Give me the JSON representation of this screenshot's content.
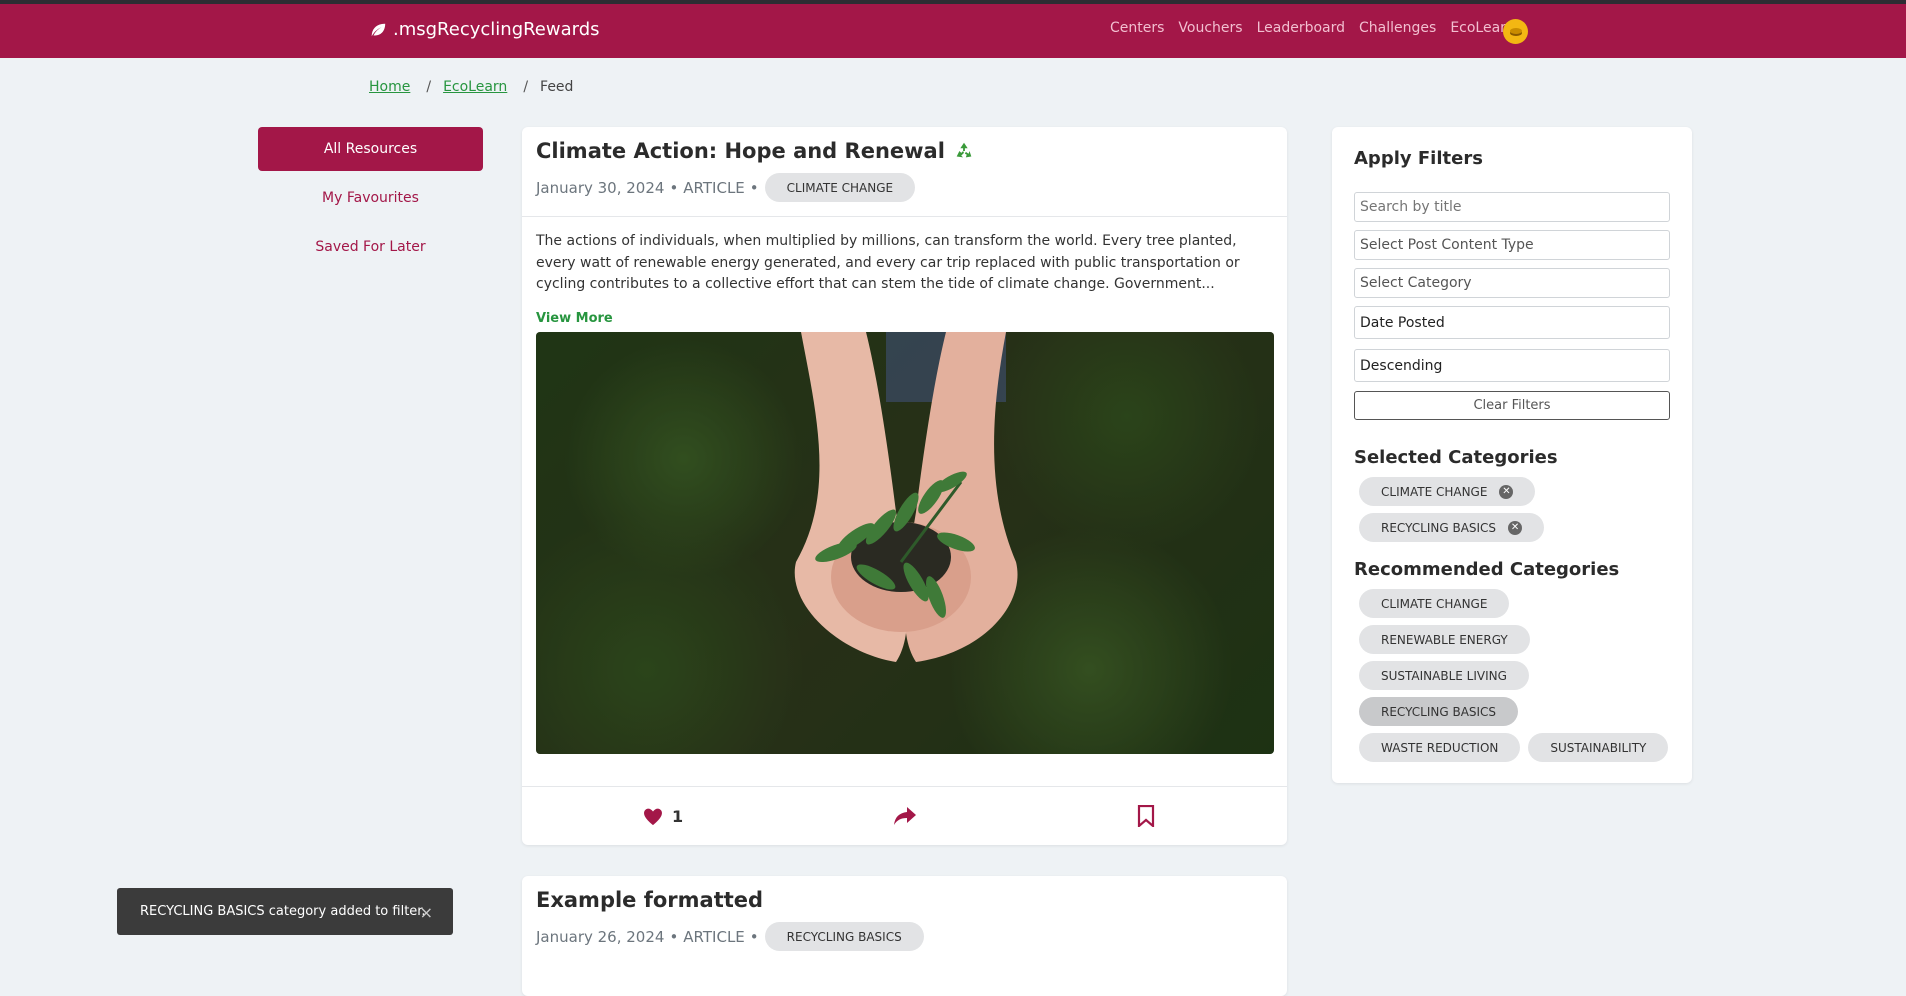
{
  "header": {
    "brand": ".msgRecyclingRewards",
    "nav": [
      "Centers",
      "Vouchers",
      "Leaderboard",
      "Challenges",
      "EcoLearn"
    ],
    "accent": "#a31748"
  },
  "breadcrumb": {
    "home": "Home",
    "ecolearn": "EcoLearn",
    "current": "Feed",
    "sep": "/"
  },
  "sidebar": {
    "items": [
      "All Resources",
      "My Favourites",
      "Saved For Later"
    ]
  },
  "posts": [
    {
      "title": "Climate Action: Hope and Renewal",
      "date": "January 30, 2024",
      "type": "ARTICLE",
      "category": "CLIMATE CHANGE",
      "body": "The actions of individuals, when multiplied by millions, can transform the world. Every tree planted, every watt of renewable energy generated, and every car trip replaced with public transportation or cycling contributes to a collective effort that can stem the tide of climate change. Government...",
      "view_more": "View More",
      "likes": "1"
    },
    {
      "title": "Example formatted",
      "date": "January 26, 2024",
      "type": "ARTICLE",
      "category": "RECYCLING BASICS"
    }
  ],
  "meta_sep": "•",
  "filters": {
    "title": "Apply Filters",
    "search_placeholder": "Search by title",
    "content_type_placeholder": "Select Post Content Type",
    "category_placeholder": "Select Category",
    "sort_by": "Date Posted",
    "order": "Descending",
    "clear": "Clear Filters",
    "selected_title": "Selected Categories",
    "selected": [
      "CLIMATE CHANGE",
      "RECYCLING BASICS"
    ],
    "recommended_title": "Recommended Categories",
    "recommended": [
      "CLIMATE CHANGE",
      "RENEWABLE ENERGY",
      "SUSTAINABLE LIVING",
      "RECYCLING BASICS",
      "WASTE REDUCTION",
      "SUSTAINABILITY"
    ]
  },
  "toast": {
    "message": "RECYCLING BASICS category added to filter.",
    "close": "×"
  }
}
